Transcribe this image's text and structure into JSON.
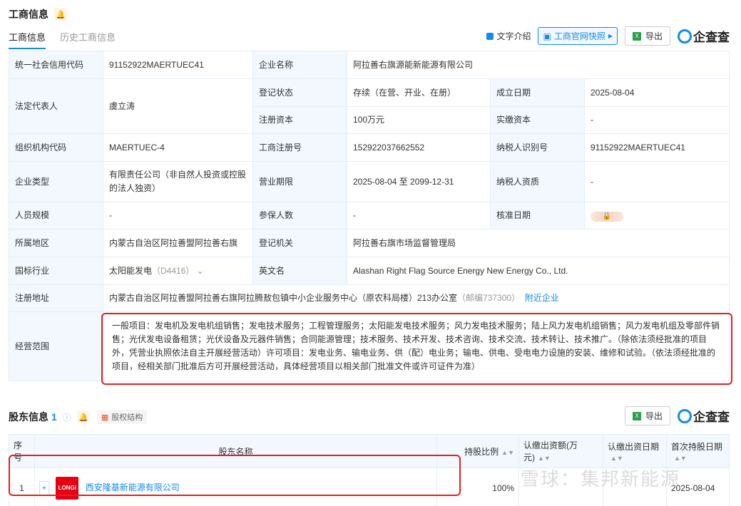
{
  "section1": {
    "title": "工商信息"
  },
  "tabs": [
    {
      "label": "工商信息"
    },
    {
      "label": "历史工商信息"
    }
  ],
  "toolbar": {
    "text_intro": "文字介绍",
    "snapshot": "工商官网快照",
    "export": "导出",
    "brand": "企查查",
    "xl_icon": "X"
  },
  "info": {
    "credit_code_label": "统一社会信用代码",
    "credit_code": "91152922MAERTUEC41",
    "company_name_label": "企业名称",
    "company_name": "阿拉善右旗源能新能源有限公司",
    "legal_rep_label": "法定代表人",
    "legal_rep": "虞立涛",
    "reg_status_label": "登记状态",
    "reg_status": "存续（在营、开业、在册）",
    "found_date_label": "成立日期",
    "found_date": "2025-08-04",
    "reg_capital_label": "注册资本",
    "reg_capital": "100万元",
    "paid_capital_label": "实缴资本",
    "paid_capital": "-",
    "org_code_label": "组织机构代码",
    "org_code": "MAERTUEC-4",
    "reg_no_label": "工商注册号",
    "reg_no": "152922037662552",
    "taxpayer_id_label": "纳税人识别号",
    "taxpayer_id": "91152922MAERTUEC41",
    "company_type_label": "企业类型",
    "company_type": "有限责任公司（非自然人投资或控股的法人独资）",
    "term_label": "营业期限",
    "term": "2025-08-04 至 2099-12-31",
    "taxpayer_qual_label": "纳税人资质",
    "taxpayer_qual": "-",
    "staff_label": "人员规模",
    "staff": "-",
    "insured_label": "参保人数",
    "insured": "-",
    "approve_date_label": "核准日期",
    "region_label": "所属地区",
    "region": "内蒙古自治区阿拉善盟阿拉善右旗",
    "authority_label": "登记机关",
    "authority": "阿拉善右旗市场监督管理局",
    "industry_label": "国标行业",
    "industry": "太阳能发电",
    "industry_code": "（D4416）",
    "en_name_label": "英文名",
    "en_name": "Alashan Right Flag Source Energy New Energy Co., Ltd.",
    "address_label": "注册地址",
    "address": "内蒙古自治区阿拉善盟阿拉善右旗阿拉腾敖包镇中小企业服务中心（原农科局楼）213办公室",
    "postcode": "（邮编737300）",
    "nearby": "附近企业",
    "scope_label": "经营范围",
    "scope": "一般项目：发电机及发电机组销售；发电技术服务；工程管理服务；太阳能发电技术服务；风力发电技术服务；陆上风力发电机组销售；风力发电机组及零部件销售；光伏发电设备租赁；光伏设备及元器件销售；合同能源管理；技术服务、技术开发、技术咨询、技术交流、技术转让、技术推广。（除依法须经批准的项目外，凭营业执照依法自主开展经营活动）许可项目：发电业务、输电业务、供（配）电业务；输电、供电、受电电力设施的安装、维修和试验。（依法须经批准的项目，经相关部门批准后方可开展经营活动，具体经营项目以相关部门批准文件或许可证件为准）"
  },
  "section2": {
    "title": "股东信息",
    "count": "1",
    "equity_btn": "股权结构"
  },
  "holders": {
    "headers": [
      "序号",
      "股东名称",
      "持股比例",
      "认缴出资额(万元)",
      "认缴出资日期",
      "首次持股日期"
    ],
    "rows": [
      {
        "index": "1",
        "name": "西安隆基新能源有限公司",
        "logo": "LONGi",
        "ratio": "100%",
        "amount": "",
        "date": "",
        "first_date": "2025-08-04"
      }
    ]
  },
  "watermark": "雪球：集邦新能源"
}
